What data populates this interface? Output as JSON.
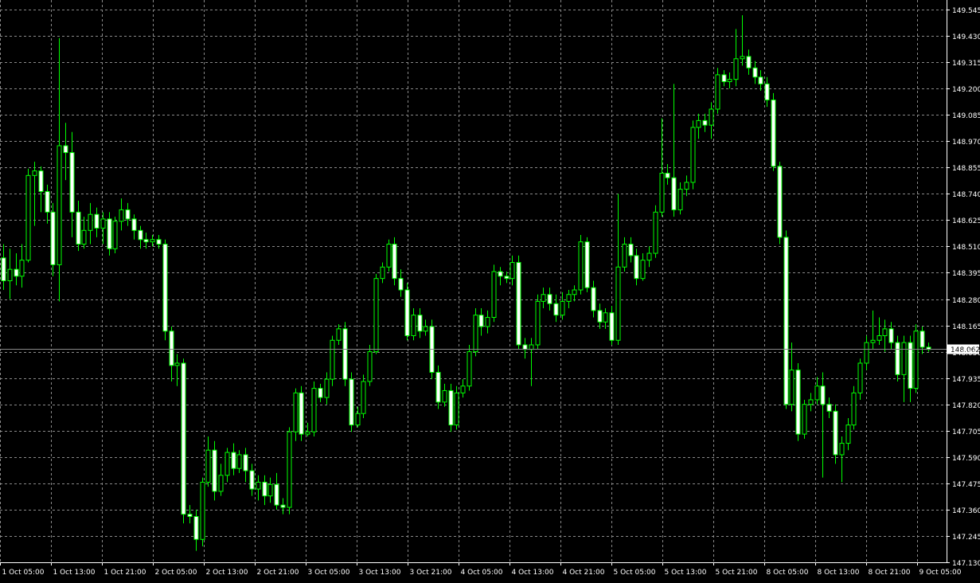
{
  "chart_data": {
    "type": "candlestick",
    "title": "",
    "xlabel": "",
    "ylabel": "",
    "ylim": [
      147.13,
      149.545
    ],
    "grid": true,
    "colors": {
      "background": "#000000",
      "grid": "#8a8a8a",
      "candle": "#00ff00",
      "bull_body": "#000000",
      "bear_body": "#ffffff",
      "axis_text": "#ffffff",
      "bid_line": "#8a8a8a",
      "price_tag_bg": "#ffffff",
      "price_tag_text": "#000000"
    },
    "y_ticks": [
      "149.545",
      "149.430",
      "149.315",
      "149.200",
      "149.085",
      "148.970",
      "148.855",
      "148.740",
      "148.625",
      "148.510",
      "148.395",
      "148.280",
      "148.165",
      "148.050",
      "147.935",
      "147.820",
      "147.705",
      "147.590",
      "147.475",
      "147.360",
      "147.245",
      "147.130"
    ],
    "x_ticks": [
      "1 Oct 05:00",
      "1 Oct 13:00",
      "1 Oct 21:00",
      "2 Oct 05:00",
      "2 Oct 13:00",
      "2 Oct 21:00",
      "3 Oct 05:00",
      "3 Oct 13:00",
      "3 Oct 21:00",
      "4 Oct 05:00",
      "4 Oct 13:00",
      "4 Oct 21:00",
      "5 Oct 05:00",
      "5 Oct 13:00",
      "5 Oct 21:00",
      "8 Oct 05:00",
      "8 Oct 13:00",
      "8 Oct 21:00",
      "9 Oct 05:00"
    ],
    "current_price": "148.062",
    "candles": [
      [
        148.46,
        148.36,
        148.52,
        148.32
      ],
      [
        148.36,
        148.41,
        148.5,
        148.28
      ],
      [
        148.41,
        148.38,
        148.48,
        148.34
      ],
      [
        148.38,
        148.45,
        148.52,
        148.33
      ],
      [
        148.45,
        148.82,
        148.85,
        148.44
      ],
      [
        148.82,
        148.84,
        148.88,
        148.6
      ],
      [
        148.84,
        148.75,
        148.86,
        148.66
      ],
      [
        148.75,
        148.66,
        148.78,
        148.61
      ],
      [
        148.66,
        148.43,
        148.7,
        148.38
      ],
      [
        148.43,
        148.95,
        149.42,
        148.27
      ],
      [
        148.95,
        148.92,
        149.05,
        148.8
      ],
      [
        148.92,
        148.66,
        149.01,
        148.55
      ],
      [
        148.66,
        148.52,
        148.71,
        148.49
      ],
      [
        148.52,
        148.58,
        148.64,
        148.5
      ],
      [
        148.58,
        148.65,
        148.7,
        148.52
      ],
      [
        148.65,
        148.59,
        148.68,
        148.55
      ],
      [
        148.59,
        148.63,
        148.66,
        148.52
      ],
      [
        148.63,
        148.5,
        148.66,
        148.47
      ],
      [
        148.5,
        148.62,
        148.64,
        148.48
      ],
      [
        148.62,
        148.67,
        148.72,
        148.58
      ],
      [
        148.67,
        148.63,
        148.7,
        148.6
      ],
      [
        148.63,
        148.58,
        148.65,
        148.54
      ],
      [
        148.58,
        148.54,
        148.6,
        148.5
      ],
      [
        148.54,
        148.53,
        148.57,
        148.5
      ],
      [
        148.53,
        148.54,
        148.56,
        148.51
      ],
      [
        148.54,
        148.52,
        148.56,
        148.5
      ],
      [
        148.52,
        148.14,
        148.54,
        148.1
      ],
      [
        148.14,
        147.99,
        148.16,
        147.92
      ],
      [
        147.99,
        148.0,
        148.04,
        147.9
      ],
      [
        148.0,
        147.34,
        148.02,
        147.3
      ],
      [
        147.34,
        147.33,
        147.38,
        147.3
      ],
      [
        147.33,
        147.23,
        147.36,
        147.18
      ],
      [
        147.23,
        147.48,
        147.5,
        147.2
      ],
      [
        147.48,
        147.62,
        147.68,
        147.46
      ],
      [
        147.62,
        147.44,
        147.66,
        147.4
      ],
      [
        147.44,
        147.51,
        147.56,
        147.42
      ],
      [
        147.51,
        147.61,
        147.63,
        147.48
      ],
      [
        147.61,
        147.54,
        147.65,
        147.51
      ],
      [
        147.54,
        147.6,
        147.62,
        147.52
      ],
      [
        147.6,
        147.53,
        147.63,
        147.48
      ],
      [
        147.53,
        147.45,
        147.56,
        147.42
      ],
      [
        147.45,
        147.48,
        147.51,
        147.4
      ],
      [
        147.48,
        147.42,
        147.51,
        147.38
      ],
      [
        147.42,
        147.47,
        147.5,
        147.39
      ],
      [
        147.47,
        147.38,
        147.52,
        147.36
      ],
      [
        147.38,
        147.37,
        147.41,
        147.34
      ],
      [
        147.37,
        147.7,
        147.72,
        147.34
      ],
      [
        147.7,
        147.87,
        147.89,
        147.66
      ],
      [
        147.87,
        147.69,
        147.9,
        147.66
      ],
      [
        147.69,
        147.7,
        147.74,
        147.68
      ],
      [
        147.7,
        147.89,
        147.92,
        147.68
      ],
      [
        147.89,
        147.85,
        147.91,
        147.83
      ],
      [
        147.85,
        147.93,
        147.96,
        147.82
      ],
      [
        147.93,
        148.1,
        148.12,
        147.9
      ],
      [
        148.1,
        148.15,
        148.17,
        148.08
      ],
      [
        148.15,
        147.93,
        148.18,
        147.9
      ],
      [
        147.93,
        147.73,
        147.96,
        147.7
      ],
      [
        147.73,
        147.78,
        147.81,
        147.72
      ],
      [
        147.78,
        147.92,
        147.95,
        147.76
      ],
      [
        147.92,
        148.05,
        148.08,
        147.9
      ],
      [
        148.05,
        148.37,
        148.39,
        148.04
      ],
      [
        148.37,
        148.42,
        148.44,
        148.35
      ],
      [
        148.42,
        148.52,
        148.54,
        148.4
      ],
      [
        148.52,
        148.37,
        148.55,
        148.34
      ],
      [
        148.37,
        148.32,
        148.41,
        148.29
      ],
      [
        148.32,
        148.12,
        148.35,
        148.1
      ],
      [
        148.12,
        148.21,
        148.24,
        148.1
      ],
      [
        148.21,
        148.14,
        148.24,
        148.11
      ],
      [
        148.14,
        148.16,
        148.19,
        148.12
      ],
      [
        148.16,
        147.96,
        148.19,
        147.93
      ],
      [
        147.96,
        147.83,
        147.99,
        147.8
      ],
      [
        147.83,
        147.88,
        147.91,
        147.81
      ],
      [
        147.88,
        147.73,
        147.91,
        147.7
      ],
      [
        147.73,
        147.87,
        147.9,
        147.71
      ],
      [
        147.87,
        147.9,
        147.93,
        147.85
      ],
      [
        147.9,
        148.05,
        148.08,
        147.88
      ],
      [
        148.05,
        148.21,
        148.24,
        148.03
      ],
      [
        148.21,
        148.16,
        148.24,
        148.12
      ],
      [
        148.16,
        148.2,
        148.23,
        148.13
      ],
      [
        148.2,
        148.4,
        148.43,
        148.18
      ],
      [
        148.4,
        148.38,
        148.42,
        148.34
      ],
      [
        148.38,
        148.37,
        148.4,
        148.35
      ],
      [
        148.37,
        148.44,
        148.47,
        148.34
      ],
      [
        148.44,
        148.08,
        148.47,
        148.06
      ],
      [
        148.08,
        148.06,
        148.11,
        148.02
      ],
      [
        148.06,
        148.08,
        148.11,
        147.9
      ],
      [
        148.08,
        148.27,
        148.3,
        148.06
      ],
      [
        148.27,
        148.3,
        148.33,
        148.24
      ],
      [
        148.3,
        148.26,
        148.33,
        148.23
      ],
      [
        148.26,
        148.21,
        148.3,
        148.18
      ],
      [
        148.21,
        148.27,
        148.31,
        148.19
      ],
      [
        148.27,
        148.3,
        148.32,
        148.24
      ],
      [
        148.3,
        148.32,
        148.34,
        148.27
      ],
      [
        148.32,
        148.53,
        148.56,
        148.3
      ],
      [
        148.53,
        148.33,
        148.55,
        148.31
      ],
      [
        148.33,
        148.23,
        148.36,
        148.2
      ],
      [
        148.23,
        148.18,
        148.26,
        148.15
      ],
      [
        148.18,
        148.22,
        148.24,
        148.15
      ],
      [
        148.22,
        148.1,
        148.25,
        148.08
      ],
      [
        148.1,
        148.42,
        148.74,
        148.08
      ],
      [
        148.42,
        148.52,
        148.55,
        148.4
      ],
      [
        148.52,
        148.47,
        148.55,
        148.44
      ],
      [
        148.47,
        148.37,
        148.5,
        148.34
      ],
      [
        148.37,
        148.45,
        148.48,
        148.36
      ],
      [
        148.45,
        148.48,
        148.51,
        148.42
      ],
      [
        148.48,
        148.66,
        148.69,
        148.46
      ],
      [
        148.66,
        148.83,
        149.07,
        148.64
      ],
      [
        148.83,
        148.81,
        148.87,
        148.78
      ],
      [
        148.81,
        148.67,
        149.22,
        148.64
      ],
      [
        148.67,
        148.76,
        148.79,
        148.65
      ],
      [
        148.76,
        148.79,
        148.82,
        148.73
      ],
      [
        148.79,
        149.03,
        149.06,
        148.76
      ],
      [
        149.03,
        149.06,
        149.09,
        148.98
      ],
      [
        149.06,
        149.04,
        149.09,
        149.01
      ],
      [
        149.04,
        149.11,
        149.14,
        148.98
      ],
      [
        149.11,
        149.26,
        149.29,
        149.09
      ],
      [
        149.26,
        149.23,
        149.28,
        149.21
      ],
      [
        149.23,
        149.24,
        149.27,
        149.2
      ],
      [
        149.24,
        149.33,
        149.46,
        149.21
      ],
      [
        149.33,
        149.34,
        149.52,
        149.3
      ],
      [
        149.34,
        149.29,
        149.37,
        149.26
      ],
      [
        149.29,
        149.25,
        149.32,
        149.22
      ],
      [
        149.25,
        149.22,
        149.28,
        149.19
      ],
      [
        149.22,
        149.15,
        149.25,
        149.12
      ],
      [
        149.15,
        148.86,
        149.18,
        148.84
      ],
      [
        148.86,
        148.55,
        148.88,
        148.52
      ],
      [
        148.55,
        147.82,
        148.58,
        147.8
      ],
      [
        147.82,
        147.97,
        148.09,
        147.79
      ],
      [
        147.97,
        147.69,
        148.0,
        147.66
      ],
      [
        147.69,
        147.82,
        147.84,
        147.67
      ],
      [
        147.82,
        147.84,
        147.87,
        147.79
      ],
      [
        147.84,
        147.9,
        147.94,
        147.82
      ],
      [
        147.9,
        147.82,
        147.96,
        147.5
      ],
      [
        147.82,
        147.79,
        147.85,
        147.76
      ],
      [
        147.79,
        147.6,
        147.82,
        147.56
      ],
      [
        147.6,
        147.65,
        147.68,
        147.48
      ],
      [
        147.65,
        147.73,
        147.76,
        147.62
      ],
      [
        147.73,
        147.87,
        147.9,
        147.71
      ],
      [
        147.87,
        148.0,
        148.02,
        147.84
      ],
      [
        148.0,
        148.09,
        148.12,
        147.97
      ],
      [
        148.09,
        148.1,
        148.23,
        148.06
      ],
      [
        148.1,
        148.12,
        148.2,
        148.08
      ],
      [
        148.12,
        148.15,
        148.19,
        148.05
      ],
      [
        148.15,
        148.09,
        148.18,
        148.06
      ],
      [
        148.09,
        147.95,
        148.12,
        147.92
      ],
      [
        147.95,
        148.09,
        148.12,
        147.83
      ],
      [
        148.09,
        147.89,
        148.12,
        147.83
      ],
      [
        147.89,
        148.14,
        148.17,
        147.87
      ],
      [
        148.14,
        148.07,
        148.16,
        148.04
      ],
      [
        148.07,
        148.06,
        148.09,
        148.05
      ]
    ]
  }
}
